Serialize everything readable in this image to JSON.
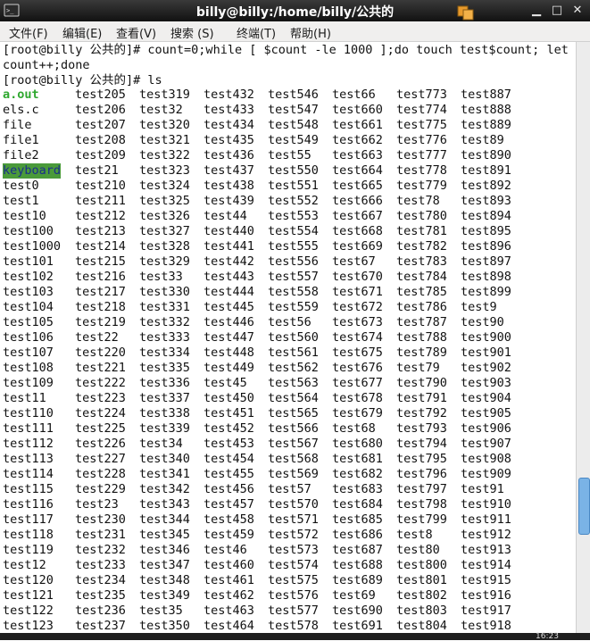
{
  "window": {
    "title": "billy@billy:/home/billy/公共的"
  },
  "menu": {
    "items": [
      "文件(F)",
      "编辑(E)",
      "查看(V)",
      "搜索 (S)",
      "终端(T)",
      "帮助(H)"
    ]
  },
  "terminal": {
    "lines": [
      "[root@billy 公共的]# count=0;while [ $count -le 1000 ];do touch test$count; let",
      "count++;done",
      "[root@billy 公共的]# ls"
    ],
    "columns": [
      [
        "a.out",
        "els.c",
        "file",
        "file1",
        "file2",
        "keyboard",
        "test0",
        "test1",
        "test10",
        "test100",
        "test1000",
        "test101",
        "test102",
        "test103",
        "test104",
        "test105",
        "test106",
        "test107",
        "test108",
        "test109",
        "test11",
        "test110",
        "test111",
        "test112",
        "test113",
        "test114",
        "test115",
        "test116",
        "test117",
        "test118",
        "test119",
        "test12",
        "test120",
        "test121",
        "test122",
        "test123"
      ],
      [
        "test205",
        "test206",
        "test207",
        "test208",
        "test209",
        "test21",
        "test210",
        "test211",
        "test212",
        "test213",
        "test214",
        "test215",
        "test216",
        "test217",
        "test218",
        "test219",
        "test22",
        "test220",
        "test221",
        "test222",
        "test223",
        "test224",
        "test225",
        "test226",
        "test227",
        "test228",
        "test229",
        "test23",
        "test230",
        "test231",
        "test232",
        "test233",
        "test234",
        "test235",
        "test236",
        "test237"
      ],
      [
        "test319",
        "test32",
        "test320",
        "test321",
        "test322",
        "test323",
        "test324",
        "test325",
        "test326",
        "test327",
        "test328",
        "test329",
        "test33",
        "test330",
        "test331",
        "test332",
        "test333",
        "test334",
        "test335",
        "test336",
        "test337",
        "test338",
        "test339",
        "test34",
        "test340",
        "test341",
        "test342",
        "test343",
        "test344",
        "test345",
        "test346",
        "test347",
        "test348",
        "test349",
        "test35",
        "test350"
      ],
      [
        "test432",
        "test433",
        "test434",
        "test435",
        "test436",
        "test437",
        "test438",
        "test439",
        "test44",
        "test440",
        "test441",
        "test442",
        "test443",
        "test444",
        "test445",
        "test446",
        "test447",
        "test448",
        "test449",
        "test45",
        "test450",
        "test451",
        "test452",
        "test453",
        "test454",
        "test455",
        "test456",
        "test457",
        "test458",
        "test459",
        "test46",
        "test460",
        "test461",
        "test462",
        "test463",
        "test464"
      ],
      [
        "test546",
        "test547",
        "test548",
        "test549",
        "test55",
        "test550",
        "test551",
        "test552",
        "test553",
        "test554",
        "test555",
        "test556",
        "test557",
        "test558",
        "test559",
        "test56",
        "test560",
        "test561",
        "test562",
        "test563",
        "test564",
        "test565",
        "test566",
        "test567",
        "test568",
        "test569",
        "test57",
        "test570",
        "test571",
        "test572",
        "test573",
        "test574",
        "test575",
        "test576",
        "test577",
        "test578"
      ],
      [
        "test66",
        "test660",
        "test661",
        "test662",
        "test663",
        "test664",
        "test665",
        "test666",
        "test667",
        "test668",
        "test669",
        "test67",
        "test670",
        "test671",
        "test672",
        "test673",
        "test674",
        "test675",
        "test676",
        "test677",
        "test678",
        "test679",
        "test68",
        "test680",
        "test681",
        "test682",
        "test683",
        "test684",
        "test685",
        "test686",
        "test687",
        "test688",
        "test689",
        "test69",
        "test690",
        "test691"
      ],
      [
        "test773",
        "test774",
        "test775",
        "test776",
        "test777",
        "test778",
        "test779",
        "test78",
        "test780",
        "test781",
        "test782",
        "test783",
        "test784",
        "test785",
        "test786",
        "test787",
        "test788",
        "test789",
        "test79",
        "test790",
        "test791",
        "test792",
        "test793",
        "test794",
        "test795",
        "test796",
        "test797",
        "test798",
        "test799",
        "test8",
        "test80",
        "test800",
        "test801",
        "test802",
        "test803",
        "test804"
      ],
      [
        "test887",
        "test888",
        "test889",
        "test89",
        "test890",
        "test891",
        "test892",
        "test893",
        "test894",
        "test895",
        "test896",
        "test897",
        "test898",
        "test899",
        "test9",
        "test90",
        "test900",
        "test901",
        "test902",
        "test903",
        "test904",
        "test905",
        "test906",
        "test907",
        "test908",
        "test909",
        "test91",
        "test910",
        "test911",
        "test912",
        "test913",
        "test914",
        "test915",
        "test916",
        "test917",
        "test918"
      ]
    ],
    "executable_files": [
      "a.out"
    ],
    "directories": [
      "keyboard"
    ]
  },
  "taskbar": {
    "clock": "16:23"
  },
  "colors": {
    "titlebar": "#1a1a1a",
    "menubar": "#f0efee",
    "exe_text": "#2fa82f",
    "dir_background": "#4a9a3a",
    "scroll_thumb": "#7ab3e6"
  },
  "icons": [
    "terminal-app-icon",
    "window-stack-icon",
    "minimize-icon",
    "maximize-icon",
    "close-icon"
  ]
}
